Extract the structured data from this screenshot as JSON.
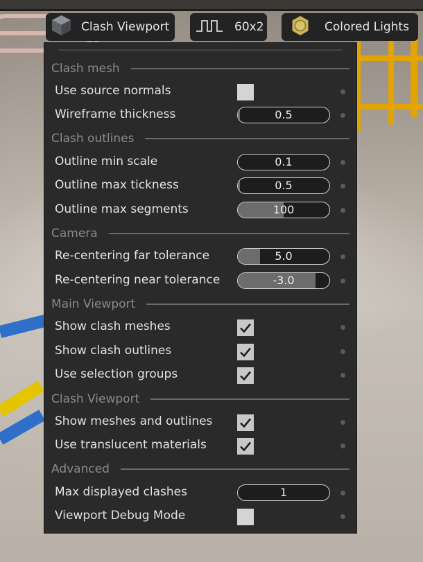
{
  "toolbar": {
    "viewport_label": "Clash Viewport",
    "resolution_label": "60x2",
    "lights_label": "Colored Lights",
    "icons": [
      "cube-icon",
      "square-wave-icon",
      "light-bulb-icon"
    ]
  },
  "sections": {
    "clash_mesh": "Clash mesh",
    "clash_outlines": "Clash outlines",
    "camera": "Camera",
    "main_viewport": "Main Viewport",
    "clash_viewport": "Clash Viewport",
    "advanced": "Advanced"
  },
  "settings": {
    "use_source_normals": {
      "label": "Use source normals",
      "checked": false
    },
    "wireframe_thickness": {
      "label": "Wireframe thickness",
      "value": "0.5",
      "fill": 0.02
    },
    "outline_min_scale": {
      "label": "Outline min scale",
      "value": "0.1",
      "fill": 0.0
    },
    "outline_max_tickness": {
      "label": "Outline max tickness",
      "value": "0.5",
      "fill": 0.02
    },
    "outline_max_segments": {
      "label": "Outline max segments",
      "value": "100",
      "fill": 0.5
    },
    "recentering_far": {
      "label": "Re-centering far tolerance",
      "value": "5.0",
      "fill": 0.24
    },
    "recentering_near": {
      "label": "Re-centering near tolerance",
      "value": "-3.0",
      "fill": 0.85
    },
    "show_clash_meshes": {
      "label": "Show clash meshes",
      "checked": true
    },
    "show_clash_outlines": {
      "label": "Show clash outlines",
      "checked": true
    },
    "use_selection_groups": {
      "label": "Use selection groups",
      "checked": true
    },
    "show_meshes_and_outlines": {
      "label": "Show meshes and outlines",
      "checked": true
    },
    "use_translucent_materials": {
      "label": "Use translucent materials",
      "checked": true
    },
    "max_displayed_clashes": {
      "label": "Max displayed clashes",
      "value": "1",
      "fill": 0.0
    },
    "viewport_debug_mode": {
      "label": "Viewport Debug Mode",
      "checked": false
    }
  },
  "colors": {
    "panel_bg": "#2a2a2a",
    "toolbar_bg": "#232323",
    "slider_fill": "#6c6c6c",
    "checkbox": "#d4d4d4",
    "icon_gold": "#c9b45a"
  }
}
